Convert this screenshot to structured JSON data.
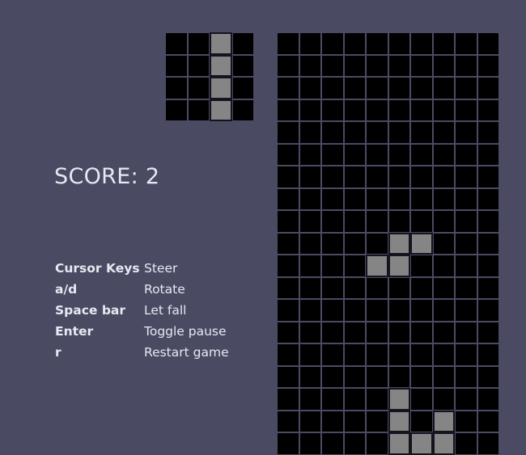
{
  "theme": {
    "background": "#4a4a63",
    "cell_empty": "#000000",
    "cell_filled": "#858585",
    "grid_line": "#4a4a63",
    "text": "#e8e8f2"
  },
  "score": {
    "label": "SCORE: 2",
    "value": 2
  },
  "preview": {
    "rows": 4,
    "cols": 4,
    "piece": "I",
    "filled": [
      [
        0,
        2
      ],
      [
        1,
        2
      ],
      [
        2,
        2
      ],
      [
        3,
        2
      ]
    ]
  },
  "board": {
    "rows": 19,
    "cols": 10,
    "filled": [
      [
        9,
        5
      ],
      [
        9,
        6
      ],
      [
        10,
        4
      ],
      [
        10,
        5
      ],
      [
        16,
        5
      ],
      [
        17,
        5
      ],
      [
        17,
        7
      ],
      [
        18,
        5
      ],
      [
        18,
        6
      ],
      [
        18,
        7
      ]
    ]
  },
  "controls": {
    "rows": [
      {
        "key": "Cursor Keys",
        "action": "Steer"
      },
      {
        "key": "a/d",
        "action": "Rotate"
      },
      {
        "key": "Space bar",
        "action": "Let fall"
      },
      {
        "key": "Enter",
        "action": "Toggle pause"
      },
      {
        "key": "r",
        "action": "Restart game"
      }
    ]
  }
}
